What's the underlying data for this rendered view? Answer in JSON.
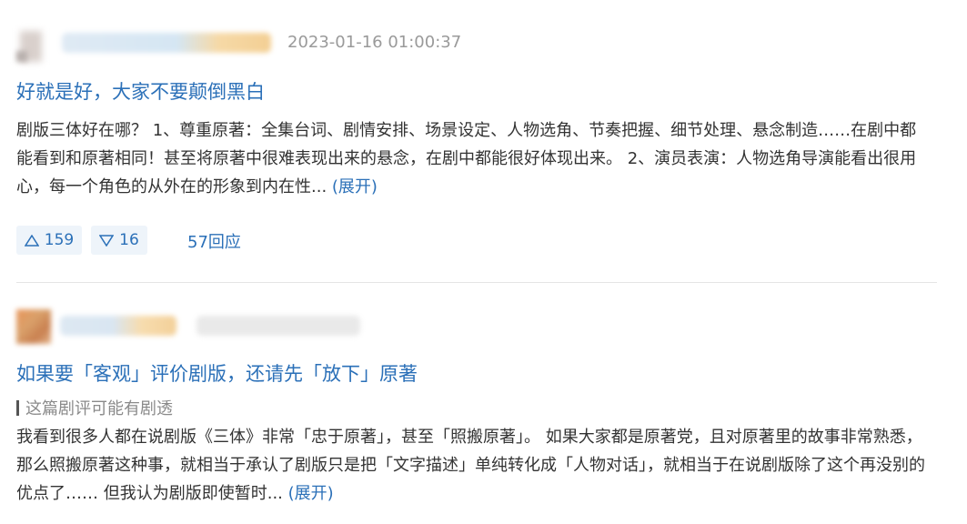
{
  "reviews": [
    {
      "timestamp": "2023-01-16 01:00:37",
      "title": "好就是好，大家不要颠倒黑白",
      "spoiler_note": "",
      "body": "剧版三体好在哪？ 1、尊重原著：全集台词、剧情安排、场景设定、人物选角、节奏把握、细节处理、悬念制造……在剧中都能看到和原著相同！甚至将原著中很难表现出来的悬念，在剧中都能很好体现出来。 2、演员表演：人物选角导演能看出很用心，每一个角色的从外在的形象到内在性... ",
      "expand_label": "(展开)",
      "upvotes": "159",
      "downvotes": "16",
      "replies": "57回应"
    },
    {
      "timestamp": "",
      "title": "如果要「客观」评价剧版，还请先「放下」原著",
      "spoiler_note": "这篇剧评可能有剧透",
      "body": "我看到很多人都在说剧版《三体》非常「忠于原著」，甚至「照搬原著」。 如果大家都是原著党，且对原著里的故事非常熟悉，那么照搬原著这种事，就相当于承认了剧版只是把「文字描述」单纯转化成「人物对话」，就相当于在说剧版除了这个再没别的优点了…… 但我认为剧版即使暂时... ",
      "expand_label": "(展开)"
    }
  ],
  "icons": {
    "upvote": "triangle-up-icon",
    "downvote": "triangle-down-icon"
  },
  "colors": {
    "link": "#2b70b8",
    "timestamp": "#9a9a9a",
    "vote_bg": "#eef4fa",
    "text": "#333333"
  }
}
